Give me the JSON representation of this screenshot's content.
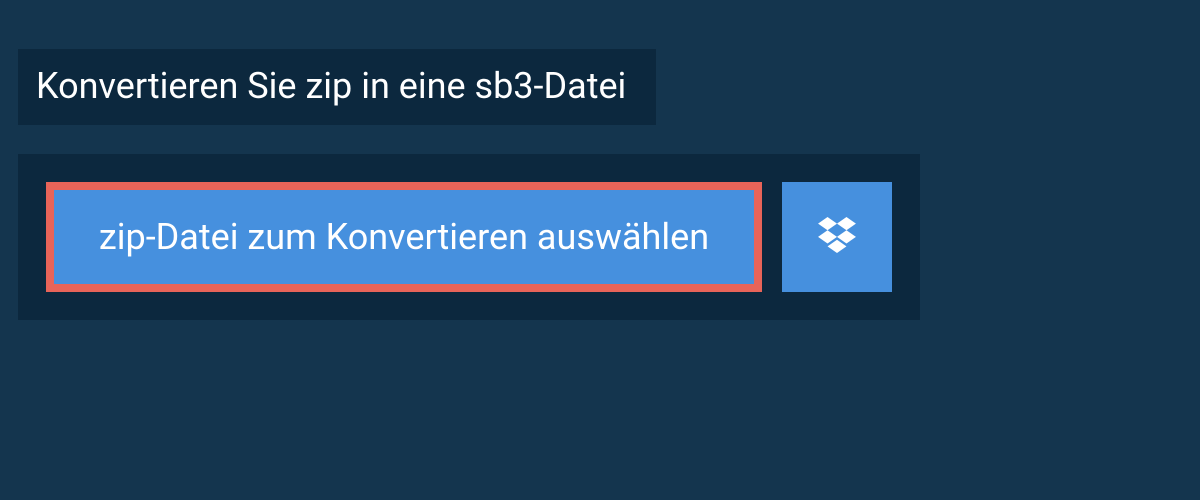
{
  "header": {
    "title": "Konvertieren Sie zip in eine sb3-Datei"
  },
  "panel": {
    "select_button_label": "zip-Datei zum Konvertieren auswählen"
  },
  "colors": {
    "page_bg": "#14354e",
    "panel_bg": "#0c283e",
    "button_bg": "#4690de",
    "highlight_border": "#e86459",
    "text": "#ffffff"
  }
}
